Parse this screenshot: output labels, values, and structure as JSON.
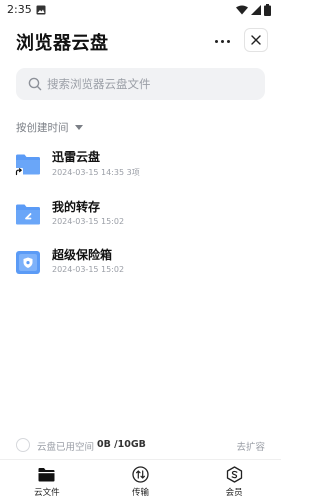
{
  "status_bar": {
    "time": "2:35",
    "icons": [
      "image-icon",
      "wifi-icon",
      "signal-icon",
      "battery-icon"
    ]
  },
  "header": {
    "title": "浏览器云盘",
    "more_icon": "more-horizontal-icon",
    "close_icon": "close-icon"
  },
  "search": {
    "placeholder": "搜索浏览器云盘文件",
    "icon": "search-icon"
  },
  "sort": {
    "label": "按创建时间",
    "icon": "caret-down-icon"
  },
  "files": [
    {
      "name": "迅雷云盘",
      "meta": "2024-03-15 14:35 3项",
      "icon": "shared-folder-icon"
    },
    {
      "name": "我的转存",
      "meta": "2024-03-15 15:02",
      "icon": "transfer-folder-icon"
    },
    {
      "name": "超级保险箱",
      "meta": "2024-03-15 15:02",
      "icon": "safe-box-icon"
    }
  ],
  "storage": {
    "label": "云盘已用空间",
    "value": "0B /10GB",
    "used_fraction": 0,
    "expand_label": "去扩容"
  },
  "bottom_nav": [
    {
      "label": "云文件",
      "icon": "folder-icon",
      "active": true
    },
    {
      "label": "传输",
      "icon": "transfer-icon",
      "active": false
    },
    {
      "label": "会员",
      "icon": "vip-icon",
      "active": false
    }
  ],
  "colors": {
    "folder_blue": "#5b9bf6",
    "folder_blue_dark": "#4a8af2",
    "search_bg": "#f1f2f4",
    "muted_text": "#9a9ea6"
  }
}
